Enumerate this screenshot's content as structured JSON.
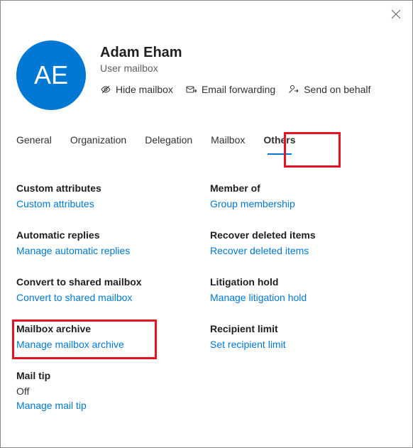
{
  "header": {
    "initials": "AE",
    "display_name": "Adam Eham",
    "subtitle": "User mailbox"
  },
  "actions": {
    "hide_mailbox": "Hide mailbox",
    "email_forwarding": "Email forwarding",
    "send_on_behalf": "Send on behalf"
  },
  "tabs": {
    "general": "General",
    "organization": "Organization",
    "delegation": "Delegation",
    "mailbox": "Mailbox",
    "others": "Others"
  },
  "sections": {
    "custom_attributes": {
      "title": "Custom attributes",
      "link": "Custom attributes"
    },
    "member_of": {
      "title": "Member of",
      "link": "Group membership"
    },
    "automatic_replies": {
      "title": "Automatic replies",
      "link": "Manage automatic replies"
    },
    "recover_deleted": {
      "title": "Recover deleted items",
      "link": "Recover deleted items"
    },
    "convert_shared": {
      "title": "Convert to shared mailbox",
      "link": "Convert to shared mailbox"
    },
    "litigation_hold": {
      "title": "Litigation hold",
      "link": "Manage litigation hold"
    },
    "mailbox_archive": {
      "title": "Mailbox archive",
      "link": "Manage mailbox archive"
    },
    "recipient_limit": {
      "title": "Recipient limit",
      "link": "Set recipient limit"
    },
    "mail_tip": {
      "title": "Mail tip",
      "value": "Off",
      "link": "Manage mail tip"
    }
  }
}
